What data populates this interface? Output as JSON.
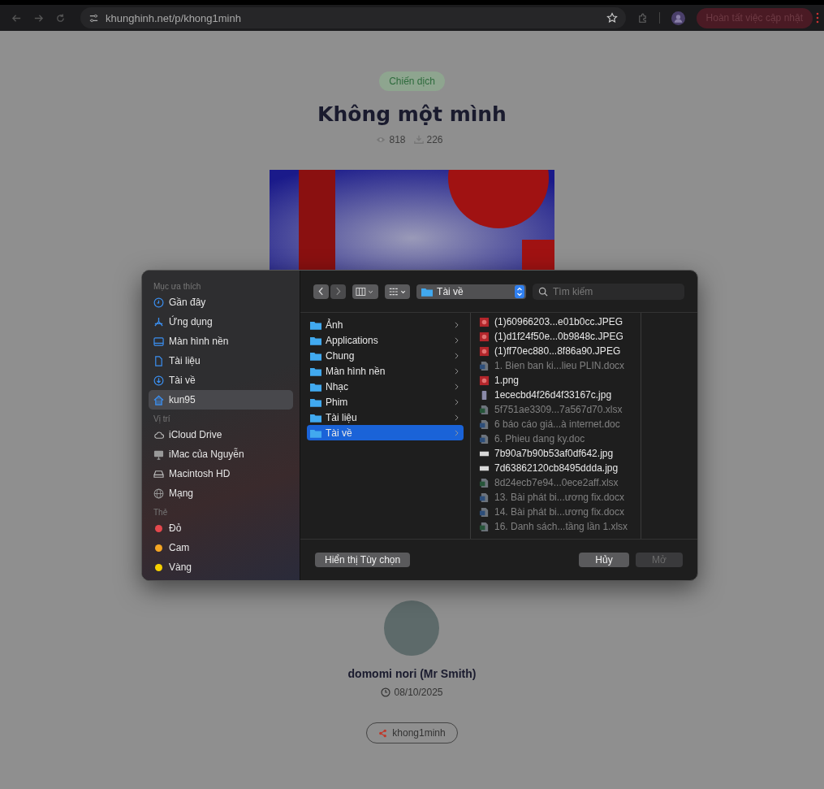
{
  "browser": {
    "url": "khunghinh.net/p/khong1minh",
    "update_button": "Hoàn tất việc cập nhật"
  },
  "page": {
    "badge": "Chiến dịch",
    "title": "Không một mình",
    "views": "818",
    "downloads": "226",
    "author": "domomi nori (Mr Smith)",
    "date": "08/10/2025",
    "tag": "khong1minh"
  },
  "dialog": {
    "sidebar": [
      {
        "heading": "Mục ưa thích",
        "items": [
          {
            "kind": "clock",
            "label": "Gần đây",
            "selected": false
          },
          {
            "kind": "apps",
            "label": "Ứng dụng",
            "selected": false
          },
          {
            "kind": "desktop",
            "label": "Màn hình nền",
            "selected": false
          },
          {
            "kind": "document",
            "label": "Tài liệu",
            "selected": false
          },
          {
            "kind": "download",
            "label": "Tài về",
            "selected": false
          },
          {
            "kind": "home",
            "label": "kun95",
            "selected": true
          }
        ]
      },
      {
        "heading": "Vị trí",
        "items": [
          {
            "kind": "cloud",
            "label": "iCloud Drive",
            "selected": false
          },
          {
            "kind": "monitor",
            "label": "iMac của Nguyễn",
            "selected": false
          },
          {
            "kind": "drive",
            "label": "Macintosh HD",
            "selected": false
          },
          {
            "kind": "globe",
            "label": "Mạng",
            "selected": false
          }
        ]
      },
      {
        "heading": "Thẻ",
        "items": [
          {
            "kind": "tag",
            "label": "Đỏ",
            "color": "#e5484d",
            "selected": false
          },
          {
            "kind": "tag",
            "label": "Cam",
            "color": "#f5a623",
            "selected": false
          },
          {
            "kind": "tag",
            "label": "Vàng",
            "color": "#f5d000",
            "selected": false
          }
        ]
      }
    ],
    "location": "Tài về",
    "search_placeholder": "Tìm kiếm",
    "folders": [
      {
        "label": "Ảnh",
        "selected": false
      },
      {
        "label": "Applications",
        "selected": false
      },
      {
        "label": "Chung",
        "selected": false
      },
      {
        "label": "Màn hình nền",
        "selected": false
      },
      {
        "label": "Nhạc",
        "selected": false
      },
      {
        "label": "Phim",
        "selected": false
      },
      {
        "label": "Tài liệu",
        "selected": false
      },
      {
        "label": "Tài về",
        "selected": true
      }
    ],
    "files": [
      {
        "kind": "image",
        "name": "(1)60966203...e01b0cc.JPEG",
        "disabled": false
      },
      {
        "kind": "image",
        "name": "(1)d1f24f50e...0b9848c.JPEG",
        "disabled": false
      },
      {
        "kind": "image",
        "name": "(1)ff70ec880...8f86a90.JPEG",
        "disabled": false
      },
      {
        "kind": "word",
        "name": "1. Bien ban ki...lieu PLIN.docx",
        "disabled": true
      },
      {
        "kind": "image",
        "name": "1.png",
        "disabled": false
      },
      {
        "kind": "phone",
        "name": "1ececbd4f26d4f33167c.jpg",
        "disabled": false
      },
      {
        "kind": "sheet",
        "name": "5f751ae3309...7a567d70.xlsx",
        "disabled": true
      },
      {
        "kind": "word",
        "name": "6 báo cáo giá...à internet.doc",
        "disabled": true
      },
      {
        "kind": "word",
        "name": "6. Phieu dang ky.doc",
        "disabled": true
      },
      {
        "kind": "thumb",
        "name": "7b90a7b90b53af0df642.jpg",
        "disabled": false
      },
      {
        "kind": "thumb",
        "name": "7d63862120cb8495ddda.jpg",
        "disabled": false
      },
      {
        "kind": "sheet",
        "name": "8d24ecb7e94...0ece2aff.xlsx",
        "disabled": true
      },
      {
        "kind": "word",
        "name": "13. Bài phát bi...ương fix.docx",
        "disabled": true
      },
      {
        "kind": "word",
        "name": "14. Bài phát bi...ương fix.docx",
        "disabled": true
      },
      {
        "kind": "sheet",
        "name": "16. Danh sách...tầng lần 1.xlsx",
        "disabled": true
      }
    ],
    "options_button": "Hiển thị Tùy chọn",
    "cancel_button": "Hủy",
    "open_button": {
      "label": "Mở",
      "disabled": true
    }
  }
}
